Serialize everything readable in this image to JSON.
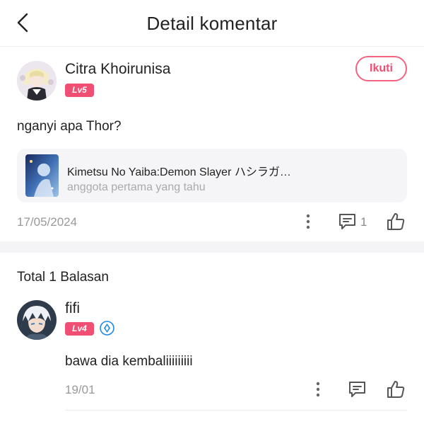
{
  "header": {
    "title": "Detail komentar",
    "back_icon": "chevron-left-icon"
  },
  "comment": {
    "username": "Citra Khoirunisa",
    "level": "Lv5",
    "follow_label": "Ikuti",
    "text": "nganyi apa Thor?",
    "reference": {
      "title": "Kimetsu No Yaiba:Demon Slayer ハシラガ…",
      "subtitle": "anggota pertama yang tahu"
    },
    "date": "17/05/2024",
    "reply_count": "1"
  },
  "replies": {
    "total_label": "Total 1 Balasan",
    "items": [
      {
        "username": "fifi",
        "level": "Lv4",
        "text": "bawa dia kembaliiiiiiiii",
        "date": "19/01"
      }
    ]
  },
  "colors": {
    "accent": "#f04e72",
    "verify": "#1e88e5"
  }
}
